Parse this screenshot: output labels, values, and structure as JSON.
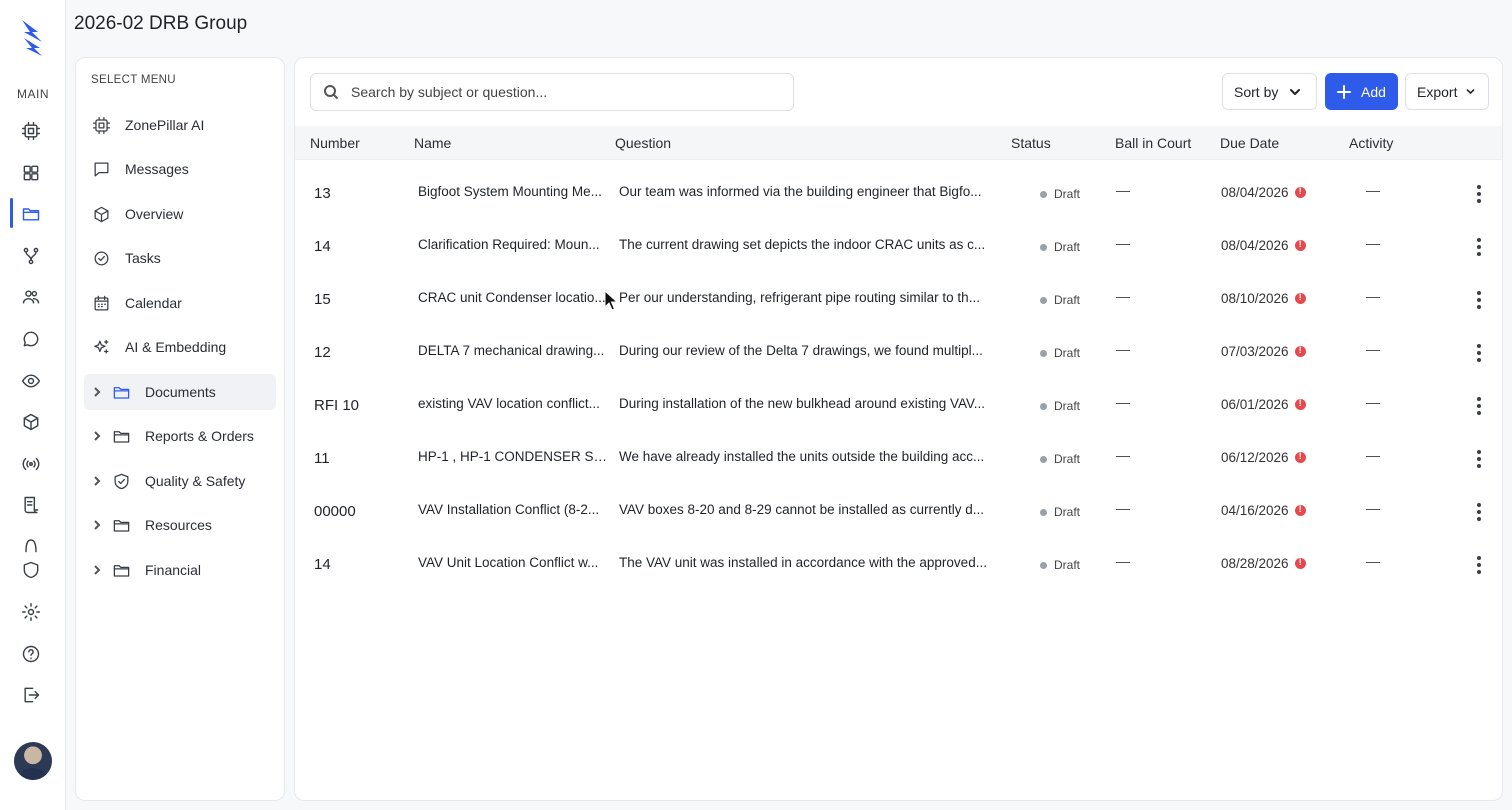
{
  "app": {
    "title": "2026-02 DRB Group",
    "rail_label": "MAIN"
  },
  "rail_icons": [
    "chip-icon",
    "grid-icon",
    "folder-icon",
    "branch-icon",
    "users-icon",
    "chat-icon",
    "eye-icon",
    "cube-icon",
    "broadcast-icon",
    "receipt-icon",
    "arch-icon",
    "shield-icon",
    "gear-icon",
    "help-icon",
    "logout-icon"
  ],
  "menu": {
    "header": "SELECT MENU",
    "items": [
      {
        "label": "ZonePillar AI",
        "icon": "chip-icon"
      },
      {
        "label": "Messages",
        "icon": "message-icon"
      },
      {
        "label": "Overview",
        "icon": "cube-icon"
      },
      {
        "label": "Tasks",
        "icon": "check-circle-icon"
      },
      {
        "label": "Calendar",
        "icon": "calendar-icon"
      },
      {
        "label": "AI & Embedding",
        "icon": "sparkles-icon"
      }
    ],
    "folders": [
      {
        "label": "Documents",
        "icon": "folder-icon",
        "active": true
      },
      {
        "label": "Reports & Orders",
        "icon": "folder-icon"
      },
      {
        "label": "Quality & Safety",
        "icon": "shield-check-icon"
      },
      {
        "label": "Resources",
        "icon": "folder-icon"
      },
      {
        "label": "Financial",
        "icon": "folder-icon"
      }
    ]
  },
  "toolbar": {
    "search_placeholder": "Search by subject or question...",
    "sort_label": "Sort by",
    "add_label": "Add",
    "export_label": "Export"
  },
  "table": {
    "columns": [
      "Number",
      "Name",
      "Question",
      "Status",
      "Ball in Court",
      "Due Date",
      "Activity"
    ],
    "rows": [
      {
        "number": "13",
        "name": "Bigfoot System Mounting Me...",
        "question": "Our team was informed via the building engineer that Bigfo...",
        "status": "Draft",
        "ball": "—",
        "due": "08/04/2026",
        "activity": "—"
      },
      {
        "number": "14",
        "name": "Clarification Required: Moun...",
        "question": "The current drawing set depicts the indoor CRAC units as c...",
        "status": "Draft",
        "ball": "—",
        "due": "08/04/2026",
        "activity": "—"
      },
      {
        "number": "15",
        "name": "CRAC unit Condenser locatio...",
        "question": "Per our understanding, refrigerant pipe routing similar to th...",
        "status": "Draft",
        "ball": "—",
        "due": "08/10/2026",
        "activity": "—"
      },
      {
        "number": "12",
        "name": "DELTA 7 mechanical drawing...",
        "question": "During our review of the Delta 7 drawings, we found multipl...",
        "status": "Draft",
        "ball": "—",
        "due": "07/03/2026",
        "activity": "—"
      },
      {
        "number": "RFI 10",
        "name": "existing VAV location conflict...",
        "question": "During installation of the new bulkhead around existing VAV...",
        "status": "Draft",
        "ball": "—",
        "due": "06/01/2026",
        "activity": "—"
      },
      {
        "number": "11",
        "name": "HP-1 , HP-1 CONDENSER Su...",
        "question": "We have already installed the units outside the building acc...",
        "status": "Draft",
        "ball": "—",
        "due": "06/12/2026",
        "activity": "—"
      },
      {
        "number": "00000",
        "name": "VAV Installation Conflict (8-2...",
        "question": "VAV boxes 8-20 and 8-29 cannot be installed as currently d...",
        "status": "Draft",
        "ball": "—",
        "due": "04/16/2026",
        "activity": "—"
      },
      {
        "number": "14",
        "name": "VAV Unit Location Conflict w...",
        "question": "The VAV unit was installed in accordance with the approved...",
        "status": "Draft",
        "ball": "—",
        "due": "08/28/2026",
        "activity": "—"
      }
    ]
  },
  "colors": {
    "accent": "#2f5bea",
    "overdue": "#e5484d",
    "draft_dot": "#9aa0a8"
  }
}
